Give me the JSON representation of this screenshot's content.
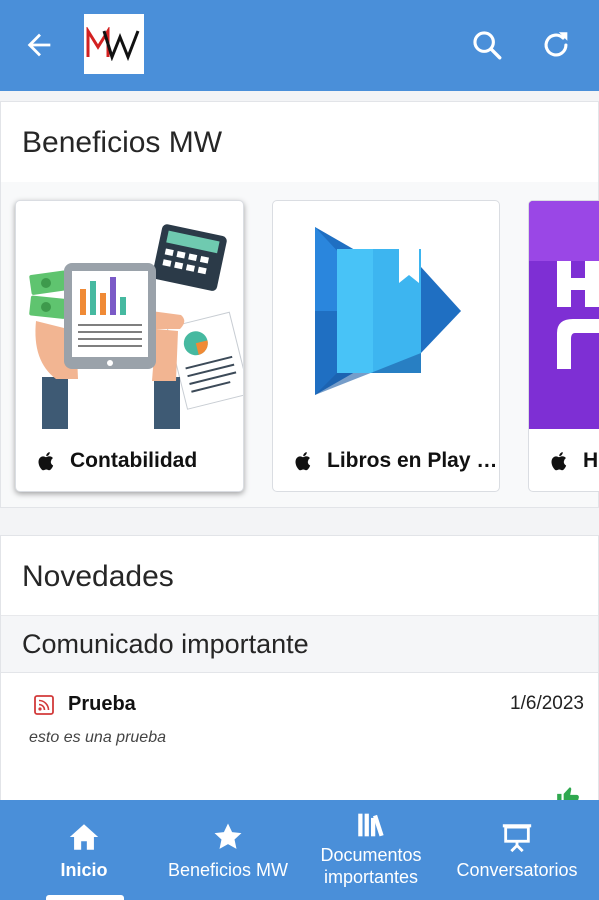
{
  "app": {
    "logo_text": "MW",
    "accent_color": "#4a8fd9"
  },
  "header": {
    "icons": [
      "back-arrow-icon",
      "search-icon",
      "refresh-icon"
    ]
  },
  "benefits": {
    "title": "Beneficios MW",
    "tiles": [
      {
        "label": "Contabilidad",
        "icon": "apple-icon"
      },
      {
        "label": "Libros en Play Books",
        "icon": "apple-icon"
      },
      {
        "label": "H",
        "icon": "apple-icon"
      }
    ]
  },
  "news": {
    "title": "Novedades",
    "category": "Comunicado importante",
    "items": [
      {
        "title": "Prueba",
        "date": "1/6/2023",
        "body": "esto es una prueba",
        "icon": "rss-icon"
      }
    ]
  },
  "bottom_nav": {
    "items": [
      {
        "label": "Inicio",
        "icon": "home-icon",
        "active": true
      },
      {
        "label": "Beneficios MW",
        "icon": "star-icon",
        "active": false
      },
      {
        "label": "Documentos importantes",
        "icon": "library-icon",
        "active": false
      },
      {
        "label": "Conversatorios",
        "icon": "presentation-icon",
        "active": false
      }
    ]
  }
}
